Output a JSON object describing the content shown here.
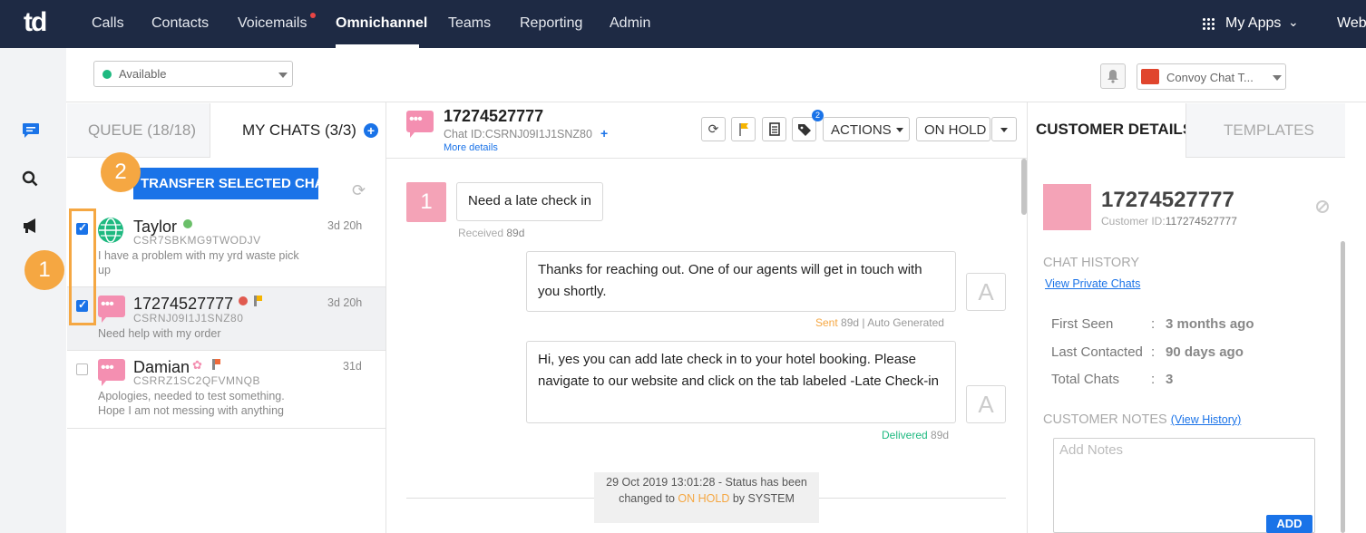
{
  "topnav": {
    "logo": "td",
    "items": [
      "Calls",
      "Contacts",
      "Voicemails",
      "Omnichannel",
      "Teams",
      "Reporting",
      "Admin"
    ],
    "active": "Omnichannel",
    "apps_label": "My Apps",
    "truncated_right": "Web"
  },
  "status": {
    "value": "Available",
    "status_color": "#1eb980",
    "conversation_select": "Convoy Chat T..."
  },
  "chat_list": {
    "tab_queue": "QUEUE (18/18)",
    "tab_mychats": "MY CHATS (3/3)",
    "transfer_button": "TRANSFER SELECTED CHAT",
    "callout_1": "1",
    "callout_2": "2",
    "rows": [
      {
        "name": "Taylor",
        "id": "CSR7SBKMG9TWODJV",
        "message": "I have a problem with my yrd waste pick up",
        "time": "3d 20h",
        "checked": true
      },
      {
        "name": "17274527777",
        "id": "CSRNJ09I1J1SNZ80",
        "message": "Need help with my order",
        "time": "3d 20h",
        "checked": true
      },
      {
        "name": "Damian",
        "id": "CSRRZ1SC2QFVMNQB",
        "message": "Apologies, needed to test something. Hope I am not messing with anything",
        "time": "31d",
        "checked": false
      }
    ]
  },
  "conversation": {
    "number": "17274527777",
    "chat_id": "Chat ID:CSRNJ09I1J1SNZ80",
    "more_details": "More details",
    "tag_badge": "2",
    "actions_label": "ACTIONS",
    "onhold_label": "ON HOLD",
    "customer_avatar": "1",
    "messages": [
      {
        "text": "Need a late check in",
        "meta_status": "Received",
        "meta_age": "89d",
        "meta_extra": ""
      },
      {
        "text": "Thanks for reaching out. One of our agents will get in touch with you shortly.",
        "meta_status": "Sent",
        "meta_age": "89d",
        "meta_extra": "| Auto Generated",
        "avatar": "A"
      },
      {
        "text": "Hi, yes you can add late check in to your hotel booking. Please navigate to our website and click on the tab labeled -Late Check-in",
        "meta_status": "Delivered",
        "meta_age": "89d",
        "meta_extra": "",
        "avatar": "A"
      }
    ],
    "system": {
      "line1": "29 Oct 2019 13:01:28 - Status has been changed to",
      "status": "ON HOLD",
      "line2": "by SYSTEM"
    }
  },
  "customer": {
    "tab_details": "CUSTOMER DETAILS",
    "tab_templates": "TEMPLATES",
    "number": "17274527777",
    "id_label": "Customer ID:",
    "id_value": "117274527777",
    "chat_history": "CHAT HISTORY",
    "view_private": "View Private Chats",
    "fields": [
      {
        "label": "First Seen",
        "value": "3 months ago"
      },
      {
        "label": "Last Contacted",
        "value": "90 days ago"
      },
      {
        "label": "Total Chats",
        "value": "3"
      }
    ],
    "notes_heading": "CUSTOMER NOTES",
    "view_history": "(View History)",
    "notes_placeholder": "Add Notes",
    "add_button": "ADD"
  },
  "colors": {
    "nav_bg": "#1e2a44",
    "accent": "#1a73e8",
    "callout": "#f5a742",
    "sent_status": "#f5a742",
    "delivered_status": "#1eb980",
    "avatar_pink": "#f4a3b7"
  }
}
